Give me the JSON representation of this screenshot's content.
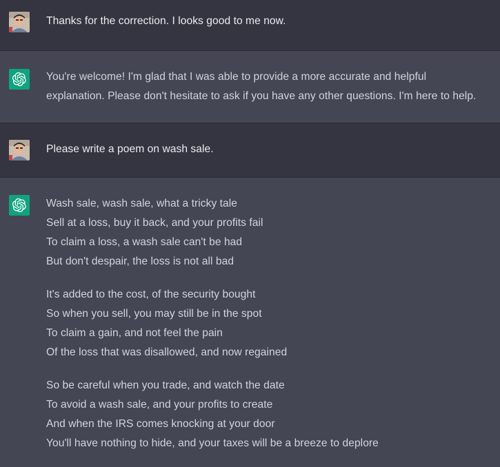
{
  "conversation": [
    {
      "role": "user",
      "avatar_icon": "user-avatar-photo",
      "text": "Thanks for the correction. I looks good to me now."
    },
    {
      "role": "assistant",
      "avatar_icon": "chatgpt-logo-icon",
      "lines": [
        "You're welcome! I'm glad that I was able to provide a more accurate and helpful",
        "explanation. Please don't hesitate to ask if you have any other questions. I'm here to help."
      ]
    },
    {
      "role": "user",
      "avatar_icon": "user-avatar-photo",
      "text": "Please write a poem on wash sale."
    },
    {
      "role": "assistant",
      "avatar_icon": "chatgpt-logo-icon",
      "stanzas": [
        [
          "Wash sale, wash sale, what a tricky tale",
          "Sell at a loss, buy it back, and your profits fail",
          "To claim a loss, a wash sale can't be had",
          "But don't despair, the loss is not all bad"
        ],
        [
          "It's added to the cost, of the security bought",
          "So when you sell, you may still be in the spot",
          "To claim a gain, and not feel the pain",
          "Of the loss that was disallowed, and now regained"
        ],
        [
          "So be careful when you trade, and watch the date",
          "To avoid a wash sale, and your profits to create",
          "And when the IRS comes knocking at your door",
          "You'll have nothing to hide, and your taxes will be a breeze to deplore"
        ]
      ]
    }
  ],
  "colors": {
    "user_bg": "#343541",
    "assistant_bg": "#444654",
    "accent": "#10a37f",
    "user_text": "#ececf1",
    "assistant_text": "#d1d5db"
  }
}
